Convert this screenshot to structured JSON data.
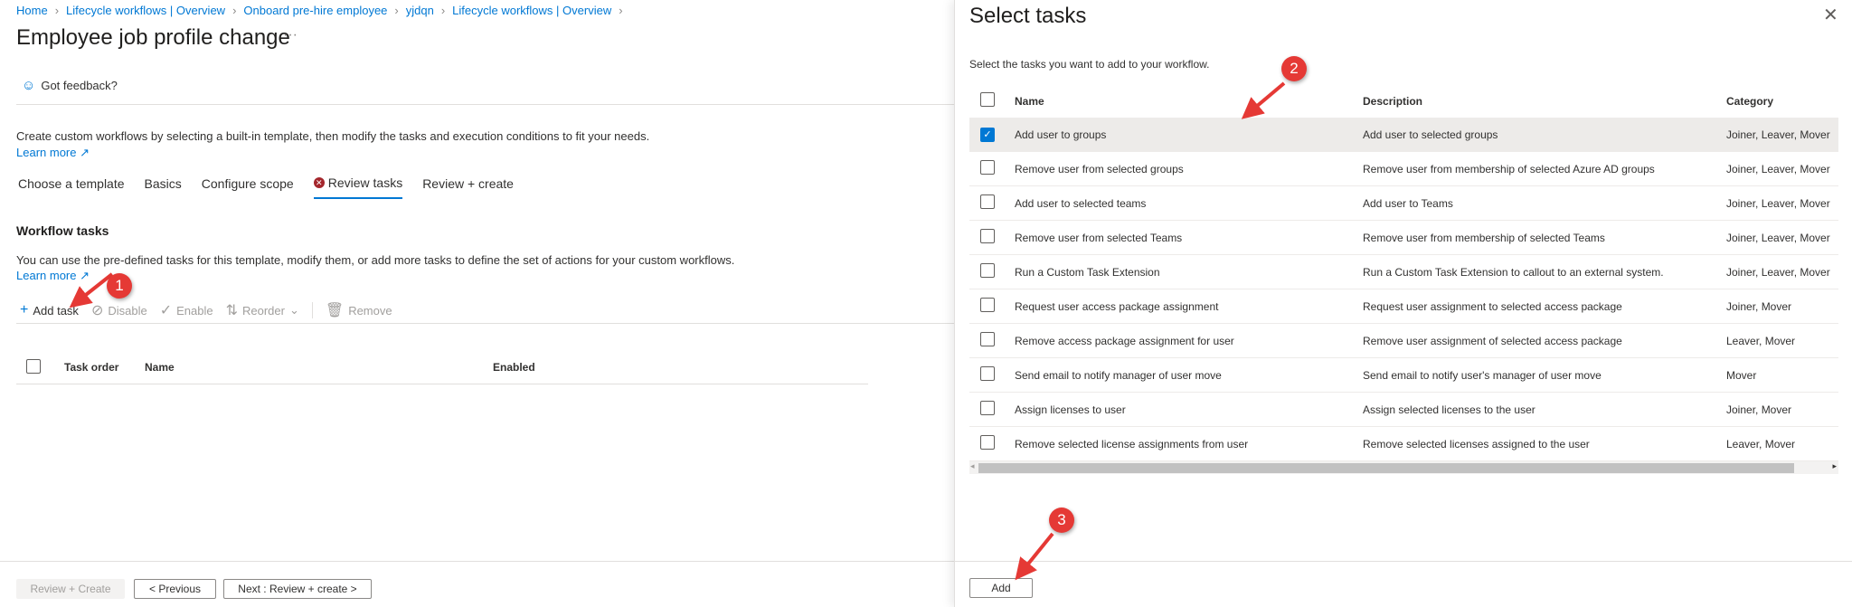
{
  "breadcrumb": [
    "Home",
    "Lifecycle workflows | Overview",
    "Onboard pre-hire employee",
    "yjdqn",
    "Lifecycle workflows | Overview"
  ],
  "page": {
    "title": "Employee job profile change",
    "more": "···",
    "feedback": "Got feedback?",
    "intro": "Create custom workflows by selecting a built-in template, then modify the tasks and execution conditions to fit your needs.",
    "learn_more": "Learn more"
  },
  "tabs": [
    {
      "label": "Choose a template"
    },
    {
      "label": "Basics"
    },
    {
      "label": "Configure scope"
    },
    {
      "label": "Review tasks",
      "active": true,
      "error": true
    },
    {
      "label": "Review + create"
    }
  ],
  "workflow_tasks": {
    "heading": "Workflow tasks",
    "desc": "You can use the pre-defined tasks for this template, modify them, or add more tasks to define the set of actions for your custom workflows.",
    "learn_more": "Learn more",
    "toolbar": {
      "add": "Add task",
      "disable": "Disable",
      "enable": "Enable",
      "reorder": "Reorder",
      "remove": "Remove"
    },
    "columns": {
      "order": "Task order",
      "name": "Name",
      "enabled": "Enabled"
    }
  },
  "footer": {
    "review_create": "Review + Create",
    "previous": "< Previous",
    "next": "Next : Review + create >"
  },
  "panel": {
    "title": "Select tasks",
    "close": "✕",
    "subtitle": "Select the tasks you want to add to your workflow.",
    "columns": {
      "name": "Name",
      "description": "Description",
      "category": "Category"
    },
    "rows": [
      {
        "name": "Add user to groups",
        "description": "Add user to selected groups",
        "category": "Joiner, Leaver, Mover",
        "checked": true
      },
      {
        "name": "Remove user from selected groups",
        "description": "Remove user from membership of selected Azure AD groups",
        "category": "Joiner, Leaver, Mover"
      },
      {
        "name": "Add user to selected teams",
        "description": "Add user to Teams",
        "category": "Joiner, Leaver, Mover"
      },
      {
        "name": "Remove user from selected Teams",
        "description": "Remove user from membership of selected Teams",
        "category": "Joiner, Leaver, Mover"
      },
      {
        "name": "Run a Custom Task Extension",
        "description": "Run a Custom Task Extension to callout to an external system.",
        "category": "Joiner, Leaver, Mover"
      },
      {
        "name": "Request user access package assignment",
        "description": "Request user assignment to selected access package",
        "category": "Joiner, Mover"
      },
      {
        "name": "Remove access package assignment for user",
        "description": "Remove user assignment of selected access package",
        "category": "Leaver, Mover"
      },
      {
        "name": "Send email to notify manager of user move",
        "description": "Send email to notify user's manager of user move",
        "category": "Mover"
      },
      {
        "name": "Assign licenses to user",
        "description": "Assign selected licenses to the user",
        "category": "Joiner, Mover"
      },
      {
        "name": "Remove selected license assignments from user",
        "description": "Remove selected licenses assigned to the user",
        "category": "Leaver, Mover"
      }
    ],
    "add": "Add"
  },
  "annotations": [
    "1",
    "2",
    "3"
  ],
  "colors": {
    "accent": "#0078d4",
    "error": "#a4262c",
    "annotation": "#e53935",
    "selected_row": "#edebe9"
  }
}
